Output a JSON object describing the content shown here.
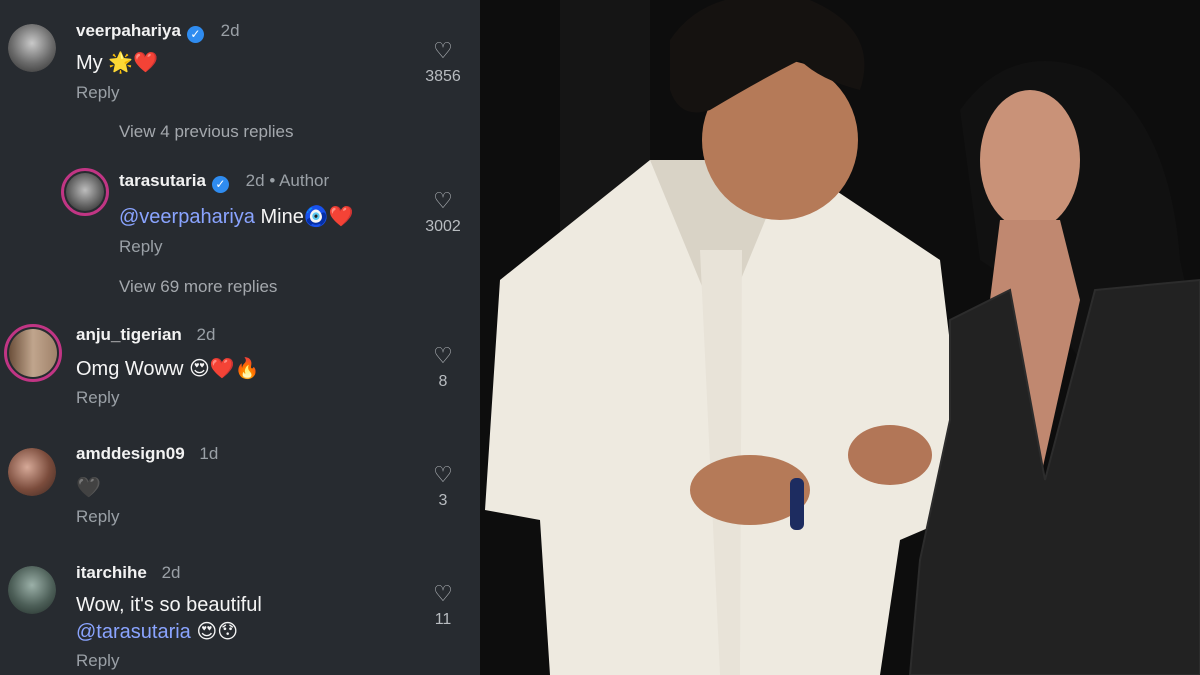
{
  "comments": [
    {
      "username": "veerpahariya",
      "verified": true,
      "time": "2d",
      "text": "My 🌟❤️",
      "reply": "Reply",
      "likes": "3856"
    },
    {
      "view_previous": "View 4 previous replies"
    },
    {
      "username": "tarasutaria",
      "verified": true,
      "time": "2d",
      "author_tag": "Author",
      "mention": "@veerpahariya",
      "text": "Mine🧿❤️",
      "reply": "Reply",
      "likes": "3002"
    },
    {
      "view_more": "View 69 more replies"
    },
    {
      "username": "anju_tigerian",
      "time": "2d",
      "text": "Omg Woww 😍❤️🔥",
      "reply": "Reply",
      "likes": "8"
    },
    {
      "username": "amddesign09",
      "time": "1d",
      "text": "🖤",
      "reply": "Reply",
      "likes": "3"
    },
    {
      "username": "itarchihe",
      "time": "2d",
      "text": "Wow, it's so beautiful",
      "mention": "@tarasutaria",
      "text2": "😍😯",
      "reply": "Reply",
      "likes": "11"
    }
  ],
  "icons": {
    "heart": "heart-outline-icon",
    "verified": "verified-badge-icon"
  },
  "colors": {
    "panel_bg": "#272b30",
    "mention": "#8aa4ff",
    "verified": "#2f8cf0"
  }
}
